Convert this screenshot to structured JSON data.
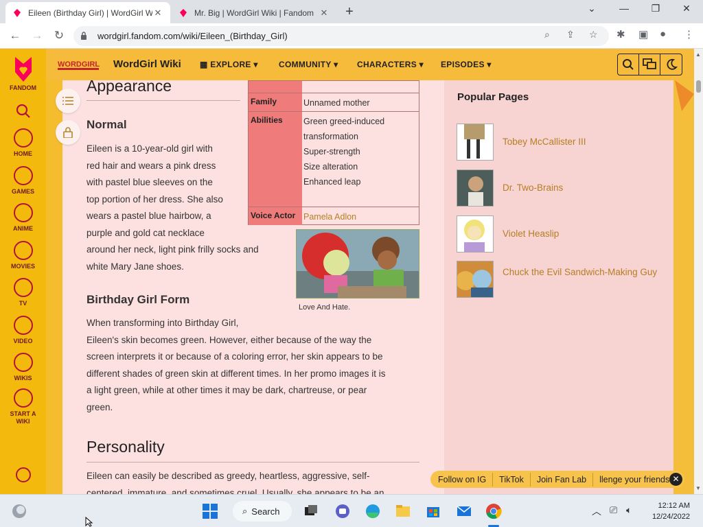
{
  "browser": {
    "tabs": [
      {
        "title": "Eileen (Birthday Girl) | WordGirl W",
        "active": true
      },
      {
        "title": "Mr. Big | WordGirl Wiki | Fandom",
        "active": false
      }
    ],
    "new_tab": "+",
    "controls": {
      "dropdown": "⌄",
      "minimize": "—",
      "restore": "❐",
      "close": "✕"
    },
    "url": "wordgirl.fandom.com/wiki/Eileen_(Birthday_Girl)"
  },
  "rail": {
    "brand": "FANDOM",
    "items": [
      {
        "label": "HOME"
      },
      {
        "label": "GAMES"
      },
      {
        "label": "ANIME"
      },
      {
        "label": "MOVIES"
      },
      {
        "label": "TV"
      },
      {
        "label": "VIDEO"
      },
      {
        "label": "WIKIS"
      },
      {
        "label": "START A WIKI"
      }
    ]
  },
  "topbar": {
    "logo_text": "WORDGIRL",
    "wiki_name": "WordGirl Wiki",
    "menus": [
      "EXPLORE",
      "COMMUNITY",
      "CHARACTERS",
      "EPISODES"
    ]
  },
  "article": {
    "appearance_heading": "Appearance",
    "normal_heading": "Normal",
    "normal_text": "Eileen is a 10-year-old girl with red hair and wears a pink dress with pastel blue sleeves on the top portion of her dress. She also wears a pastel blue hairbow, a purple and gold cat necklace around her neck, light pink frilly socks and white Mary Jane shoes.",
    "normal_lines": [
      "Eileen is a 10-year-old girl with",
      "red hair and wears a pink dress",
      "with pastel blue sleeves on the",
      "top portion of her dress. She also",
      "wears a pastel blue hairbow, a",
      "purple and gold cat necklace",
      "around her neck, light pink frilly socks and",
      "white Mary Jane shoes."
    ],
    "bg_heading": "Birthday Girl Form",
    "bg_lines": [
      "When transforming into Birthday Girl,",
      "Eileen's skin becomes green. However, either because of the way the",
      "screen interprets it or because of a coloring error, her skin appears to be",
      "different shades of green skin at different times. In her promo images it is",
      "a light green, while at other times it may be dark, chartreuse, or pear",
      "green."
    ],
    "personality_heading": "Personality",
    "personality_lines": [
      "Eileen can easily be described as greedy, heartless, aggressive, self-",
      "centered, immature, and sometimes cruel. Usually, she appears to be an"
    ],
    "infobox": {
      "family_label": "Family",
      "family_value": "Unnamed mother",
      "abilities_label": "Abilities",
      "abilities": [
        "Green greed-induced",
        "transformation",
        "Super-strength",
        "Size alteration",
        "Enhanced leap"
      ],
      "voice_label": "Voice Actor",
      "voice_value": "Pamela Adlon"
    },
    "image_caption": "Love And Hate."
  },
  "popular": {
    "title": "Popular Pages",
    "items": [
      {
        "name": "Tobey McCallister III"
      },
      {
        "name": "Dr. Two-Brains"
      },
      {
        "name": "Violet Heaslip"
      },
      {
        "name": "Chuck the Evil Sandwich-Making Guy"
      }
    ]
  },
  "follow_bar": [
    "Follow on IG",
    "TikTok",
    "Join Fan Lab",
    "llenge your friends!"
  ],
  "taskbar": {
    "search": "Search",
    "time": "12:12 AM",
    "date": "12/24/2022"
  },
  "colors": {
    "rail": "#f4b90d",
    "topbar": "#f7bb3c",
    "content_bg": "#fde1e0",
    "infobox_label": "#ef7b7b",
    "link": "#b57f25"
  }
}
